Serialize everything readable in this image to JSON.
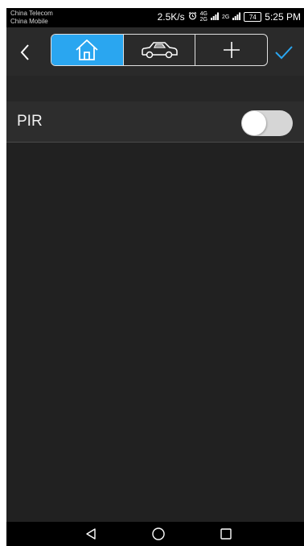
{
  "status_bar": {
    "carrier_1": "China Telecom",
    "carrier_2": "China Mobile",
    "speed": "2.5K/s",
    "network_top": "4G",
    "network_bottom": "2G",
    "network_2": "2G",
    "battery": "74",
    "time": "5:25 PM"
  },
  "toolbar": {
    "tabs": [
      {
        "name": "home",
        "icon": "home-icon",
        "active": true
      },
      {
        "name": "car",
        "icon": "car-icon",
        "active": false
      },
      {
        "name": "add",
        "icon": "plus-icon",
        "active": false
      }
    ]
  },
  "settings": {
    "items": [
      {
        "label": "PIR",
        "enabled": false
      }
    ]
  },
  "colors": {
    "accent": "#2aa6f0",
    "background": "#212121",
    "row": "#2d2d2d"
  }
}
